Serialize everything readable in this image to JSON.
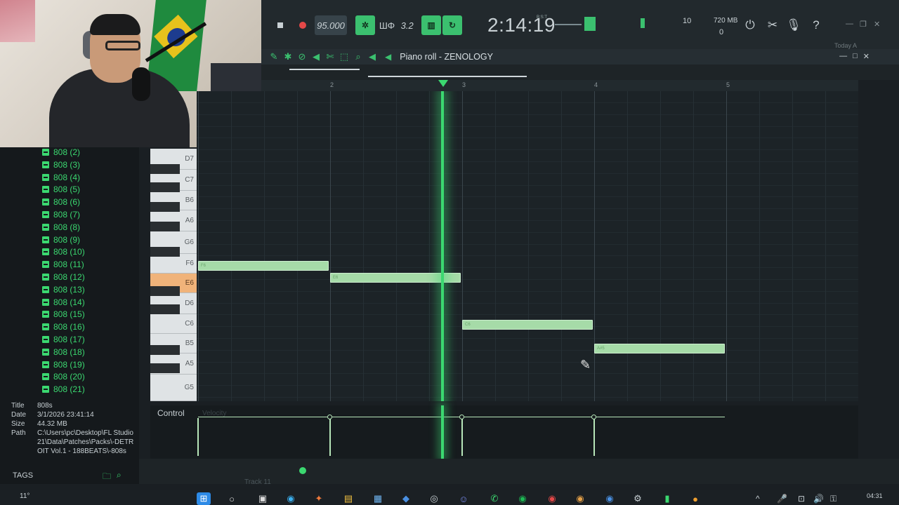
{
  "toolbar": {
    "tempo": "95.000",
    "time": "2:14:19",
    "time_sub": "B:S:T",
    "pat_label": "ШΦ",
    "step_label": "3.2 ",
    "cpu": "10",
    "memory": "720 MB",
    "poly": "0",
    "today_label": "Today A"
  },
  "piano_roll": {
    "title": "Piano roll - ZENOLOGY",
    "bar_numbers": [
      "2",
      "3",
      "4",
      "5"
    ],
    "notes": [
      {
        "label": "F6"
      },
      {
        "label": "E6"
      },
      {
        "label": "C6"
      },
      {
        "label": "A#5"
      }
    ]
  },
  "piano": {
    "keys": [
      "D7",
      "C7",
      "B6",
      "A6",
      "G6",
      "F6",
      "E6",
      "D6",
      "C6",
      "B5",
      "A5",
      "G5"
    ],
    "highlighted": "E6"
  },
  "browser": {
    "items": [
      "808 (2)",
      "808 (3)",
      "808 (4)",
      "808 (5)",
      "808 (6)",
      "808 (7)",
      "808 (8)",
      "808 (9)",
      "808 (10)",
      "808 (11)",
      "808 (12)",
      "808 (13)",
      "808 (14)",
      "808 (15)",
      "808 (16)",
      "808 (17)",
      "808 (18)",
      "808 (19)",
      "808 (20)",
      "808 (21)"
    ],
    "info": {
      "title_key": "Title",
      "title_val": "808s",
      "date_key": "Date",
      "date_val": "3/1/2026 23:41:14",
      "size_key": "Size",
      "size_val": "44.32 MB",
      "path_key": "Path",
      "path_val": "C:\\Users\\pc\\Desktop\\FL Studio 21\\Data\\Patches\\Packs\\-DETROIT Vol.1 - 188BEATS\\-808s"
    },
    "tags_label": "TAGS"
  },
  "control": {
    "label": "Control",
    "velocity_label": "Velocity"
  },
  "status": {
    "track_label": "Track 11"
  },
  "taskbar": {
    "temperature": "11°",
    "time": "04:31",
    "date": "02/11/2026"
  },
  "colors": {
    "accent": "#3bd870",
    "note": "#a6dba8",
    "highlight_key": "#f0b37a"
  }
}
